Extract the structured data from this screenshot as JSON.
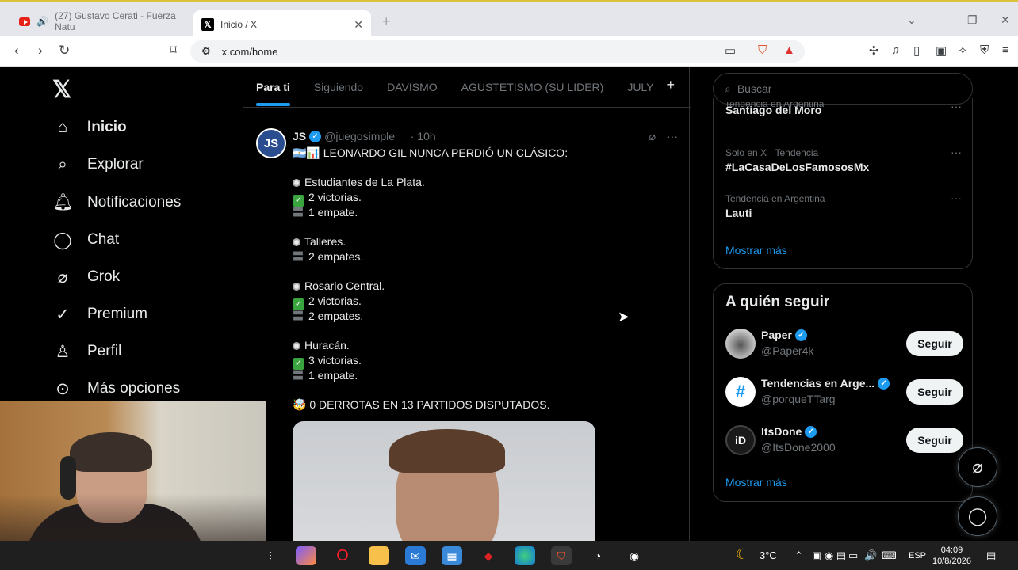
{
  "browser": {
    "tabs": [
      {
        "title": "(27) Gustavo Cerati - Fuerza Natu",
        "active": false
      },
      {
        "title": "Inicio / X",
        "active": true
      }
    ],
    "url": "x.com/home",
    "brave_badge": "1"
  },
  "leftnav": {
    "items": [
      {
        "label": "Inicio",
        "icon": "home-icon"
      },
      {
        "label": "Explorar",
        "icon": "search-icon"
      },
      {
        "label": "Notificaciones",
        "icon": "bell-icon"
      },
      {
        "label": "Chat",
        "icon": "chat-icon"
      },
      {
        "label": "Grok",
        "icon": "grok-icon"
      },
      {
        "label": "Premium",
        "icon": "premium-icon"
      },
      {
        "label": "Perfil",
        "icon": "person-icon"
      },
      {
        "label": "Más opciones",
        "icon": "more-icon"
      }
    ]
  },
  "feed": {
    "tabs": [
      "Para ti",
      "Siguiendo",
      "DAVISMO",
      "AGUSTETISMO (SU LIDER)",
      "JULY"
    ],
    "tweet": {
      "avatar_text": "JS",
      "name": "JS",
      "handle": "@juegosimple__",
      "time": "10h",
      "headline": "LEONARDO GIL NUNCA PERDIÓ UN CLÁSICO:",
      "blocks": [
        {
          "team": "Estudiantes de La Plata.",
          "lines": [
            "2 victorias.",
            "1 empate."
          ],
          "kinds": [
            "win",
            "draw"
          ]
        },
        {
          "team": "Talleres.",
          "lines": [
            "2 empates."
          ],
          "kinds": [
            "draw"
          ]
        },
        {
          "team": "Rosario Central.",
          "lines": [
            "2 victorias.",
            "2 empates."
          ],
          "kinds": [
            "win",
            "draw"
          ]
        },
        {
          "team": "Huracán.",
          "lines": [
            "3 victorias.",
            "1 empate."
          ],
          "kinds": [
            "win",
            "draw"
          ]
        }
      ],
      "footer": "0 DERROTAS EN 13 PARTIDOS DISPUTADOS."
    }
  },
  "right": {
    "search_placeholder": "Buscar",
    "trends_clipped_meta": "Tendencia en Argentina",
    "trends": [
      {
        "meta": "",
        "topic": "Santiago del Moro"
      },
      {
        "meta": "Solo en X · Tendencia",
        "topic": "#LaCasaDeLosFamososMx"
      },
      {
        "meta": "Tendencia en Argentina",
        "topic": "Lauti"
      }
    ],
    "show_more": "Mostrar más",
    "who_to_follow_title": "A quién seguir",
    "accounts": [
      {
        "name": "Paper",
        "handle": "@Paper4k",
        "button": "Seguir"
      },
      {
        "name": "Tendencias en Arge...",
        "handle": "@porqueTTarg",
        "button": "Seguir"
      },
      {
        "name": "ItsDone",
        "handle": "@ItsDone2000",
        "button": "Seguir"
      }
    ]
  },
  "taskbar": {
    "temperature": "3°C",
    "language": "ESP",
    "time": "04:09",
    "date": "10/8/2026"
  }
}
